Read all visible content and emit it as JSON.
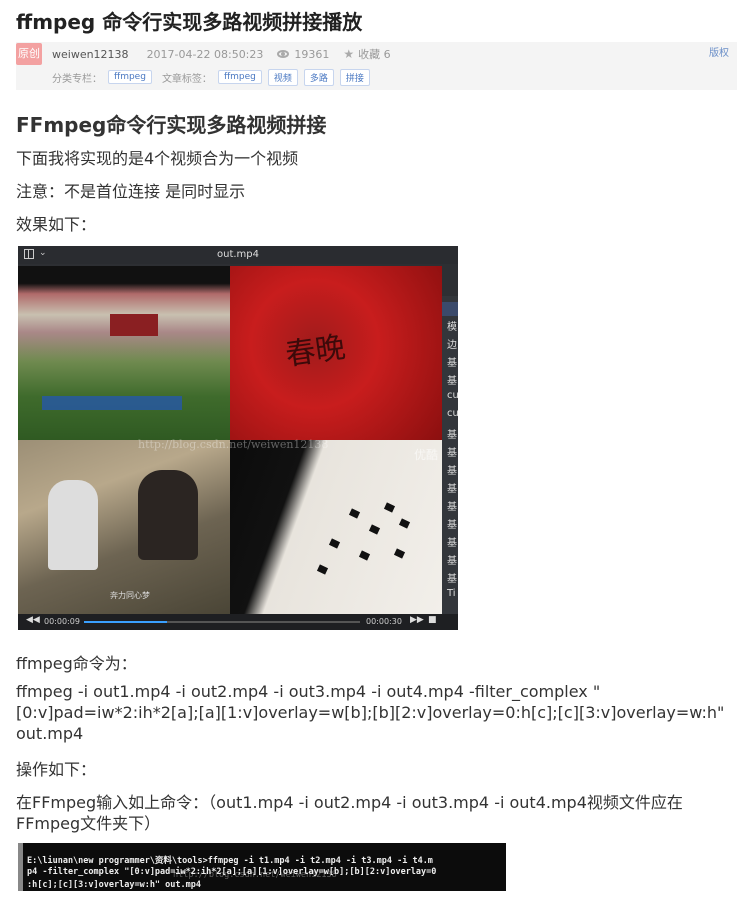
{
  "title": "ffmpeg 命令行实现多路视频拼接播放",
  "meta": {
    "original_badge": "原创",
    "author": "weiwen12138",
    "date": "2017-04-22 08:50:23",
    "views": "19361",
    "favorites": "收藏 6",
    "copyright": "版权",
    "category_label": "分类专栏：",
    "categories": [
      "ffmpeg"
    ],
    "tags_label": "文章标签：",
    "tags": [
      "ffmpeg",
      "视频",
      "多路",
      "拼接"
    ]
  },
  "article": {
    "heading": "FFmpeg命令行实现多路视频拼接",
    "intro": "下面我将实现的是4个视频合为一个视频",
    "note": "注意：不是首位连接 是同时显示",
    "effect_label": "效果如下：",
    "cmd_label": "ffmpeg命令为：",
    "cmd_line1": "ffmpeg -i out1.mp4 -i out2.mp4 -i out3.mp4 -i out4.mp4 -filter_complex \"",
    "cmd_line2": "[0:v]pad=iw*2:ih*2[a];[a][1:v]overlay=w[b];[b][2:v]overlay=0:h[c];[c][3:v]overlay=w:h\"",
    "cmd_line3": "out.mp4",
    "op_label": "操作如下：",
    "op_line1": "在FFmpeg输入如上命令：（out1.mp4 -i out2.mp4 -i out3.mp4 -i out4.mp4视频文件应在",
    "op_line2": "FFmpeg文件夹下）"
  },
  "player": {
    "filename": "out.mp4",
    "current_time": "00:00:09",
    "total_time": "00:00:30",
    "progress": 0.3,
    "watermark": "http://blog.csdn.net/weiwen12138",
    "corner_text": "优酷",
    "q2_text": "春晚",
    "q3_caption": "奔力同心梦",
    "side_items": [
      "模",
      "边",
      "基",
      "基",
      "cu",
      "cu",
      "基",
      "基",
      "基",
      "基",
      "基",
      "基",
      "基",
      "基",
      "基",
      "Ti"
    ]
  },
  "terminal": {
    "line1": "E:\\liunan\\new programmer\\资料\\tools>ffmpeg -i t1.mp4 -i t2.mp4 -i t3.mp4 -i t4.m",
    "line2": "p4 -filter_complex \"[0:v]pad=iw*2:ih*2[a];[a][1:v]overlay=w[b];[b][2:v]overlay=0",
    "line3": ":h[c];[c][3:v]overlay=w:h\" out.mp4",
    "watermark": "http://blog.csdn.net/weiwen12138"
  }
}
